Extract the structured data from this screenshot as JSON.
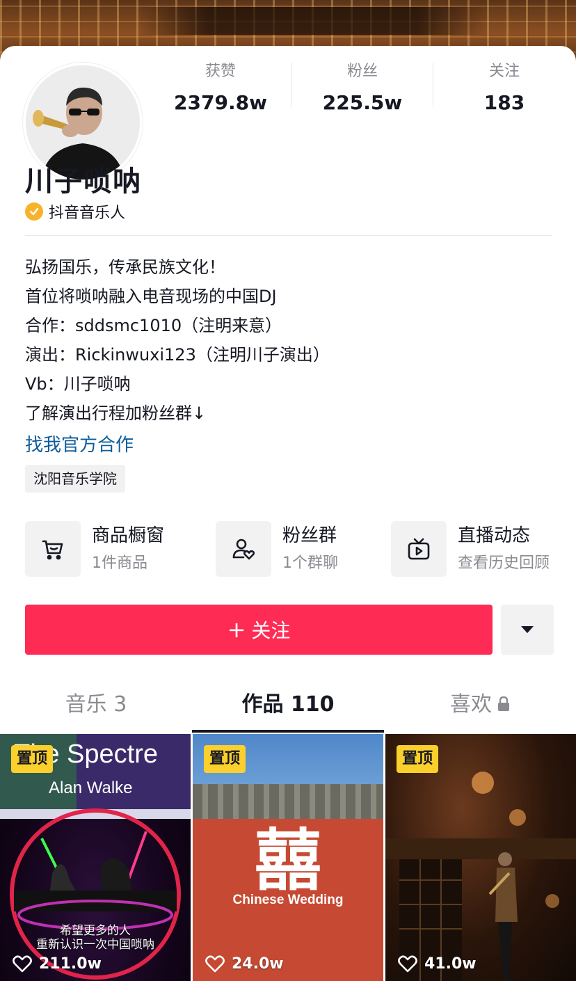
{
  "profile": {
    "name": "川子唢呐",
    "verified_label": "抖音音乐人"
  },
  "stats": [
    {
      "label": "获赞",
      "value": "2379.8w"
    },
    {
      "label": "粉丝",
      "value": "225.5w"
    },
    {
      "label": "关注",
      "value": "183"
    }
  ],
  "bio": {
    "lines": [
      "弘扬国乐，传承民族文化！",
      "首位将唢呐融入电音现场的中国DJ",
      "合作：sddsmc1010（注明来意）",
      "演出：Rickinwuxi123（注明川子演出）",
      "Vb：川子唢呐",
      "了解演出行程加粉丝群↓"
    ],
    "link": "找我官方合作",
    "school_tag": "沈阳音乐学院"
  },
  "tools": [
    {
      "title": "商品橱窗",
      "subtitle": "1件商品",
      "icon": "cart-icon"
    },
    {
      "title": "粉丝群",
      "subtitle": "1个群聊",
      "icon": "fan-group-icon"
    },
    {
      "title": "直播动态",
      "subtitle": "查看历史回顾",
      "icon": "live-tv-icon"
    }
  ],
  "actions": {
    "follow_plus": "+",
    "follow_label": "关注"
  },
  "tabs": [
    {
      "label": "音乐 3",
      "active": false
    },
    {
      "label": "作品 110",
      "active": true
    },
    {
      "label": "喜欢",
      "active": false,
      "locked": true
    }
  ],
  "videos": [
    {
      "pin": "置顶",
      "likes": "211.0w",
      "title_text": "The Spectre",
      "subtitle_text": "Alan Walke",
      "caption_lines": [
        "希望更多的人",
        "重新认识一次中国唢呐"
      ]
    },
    {
      "pin": "置顶",
      "likes": "24.0w",
      "symbol_text": "囍",
      "caption_text": "Chinese Wedding"
    },
    {
      "pin": "置顶",
      "likes": "41.0w"
    }
  ],
  "colors": {
    "accent": "#fe2c55",
    "link": "#0f5c99",
    "pin_badge": "#fbd02c",
    "verified_badge": "#f7b32b"
  }
}
